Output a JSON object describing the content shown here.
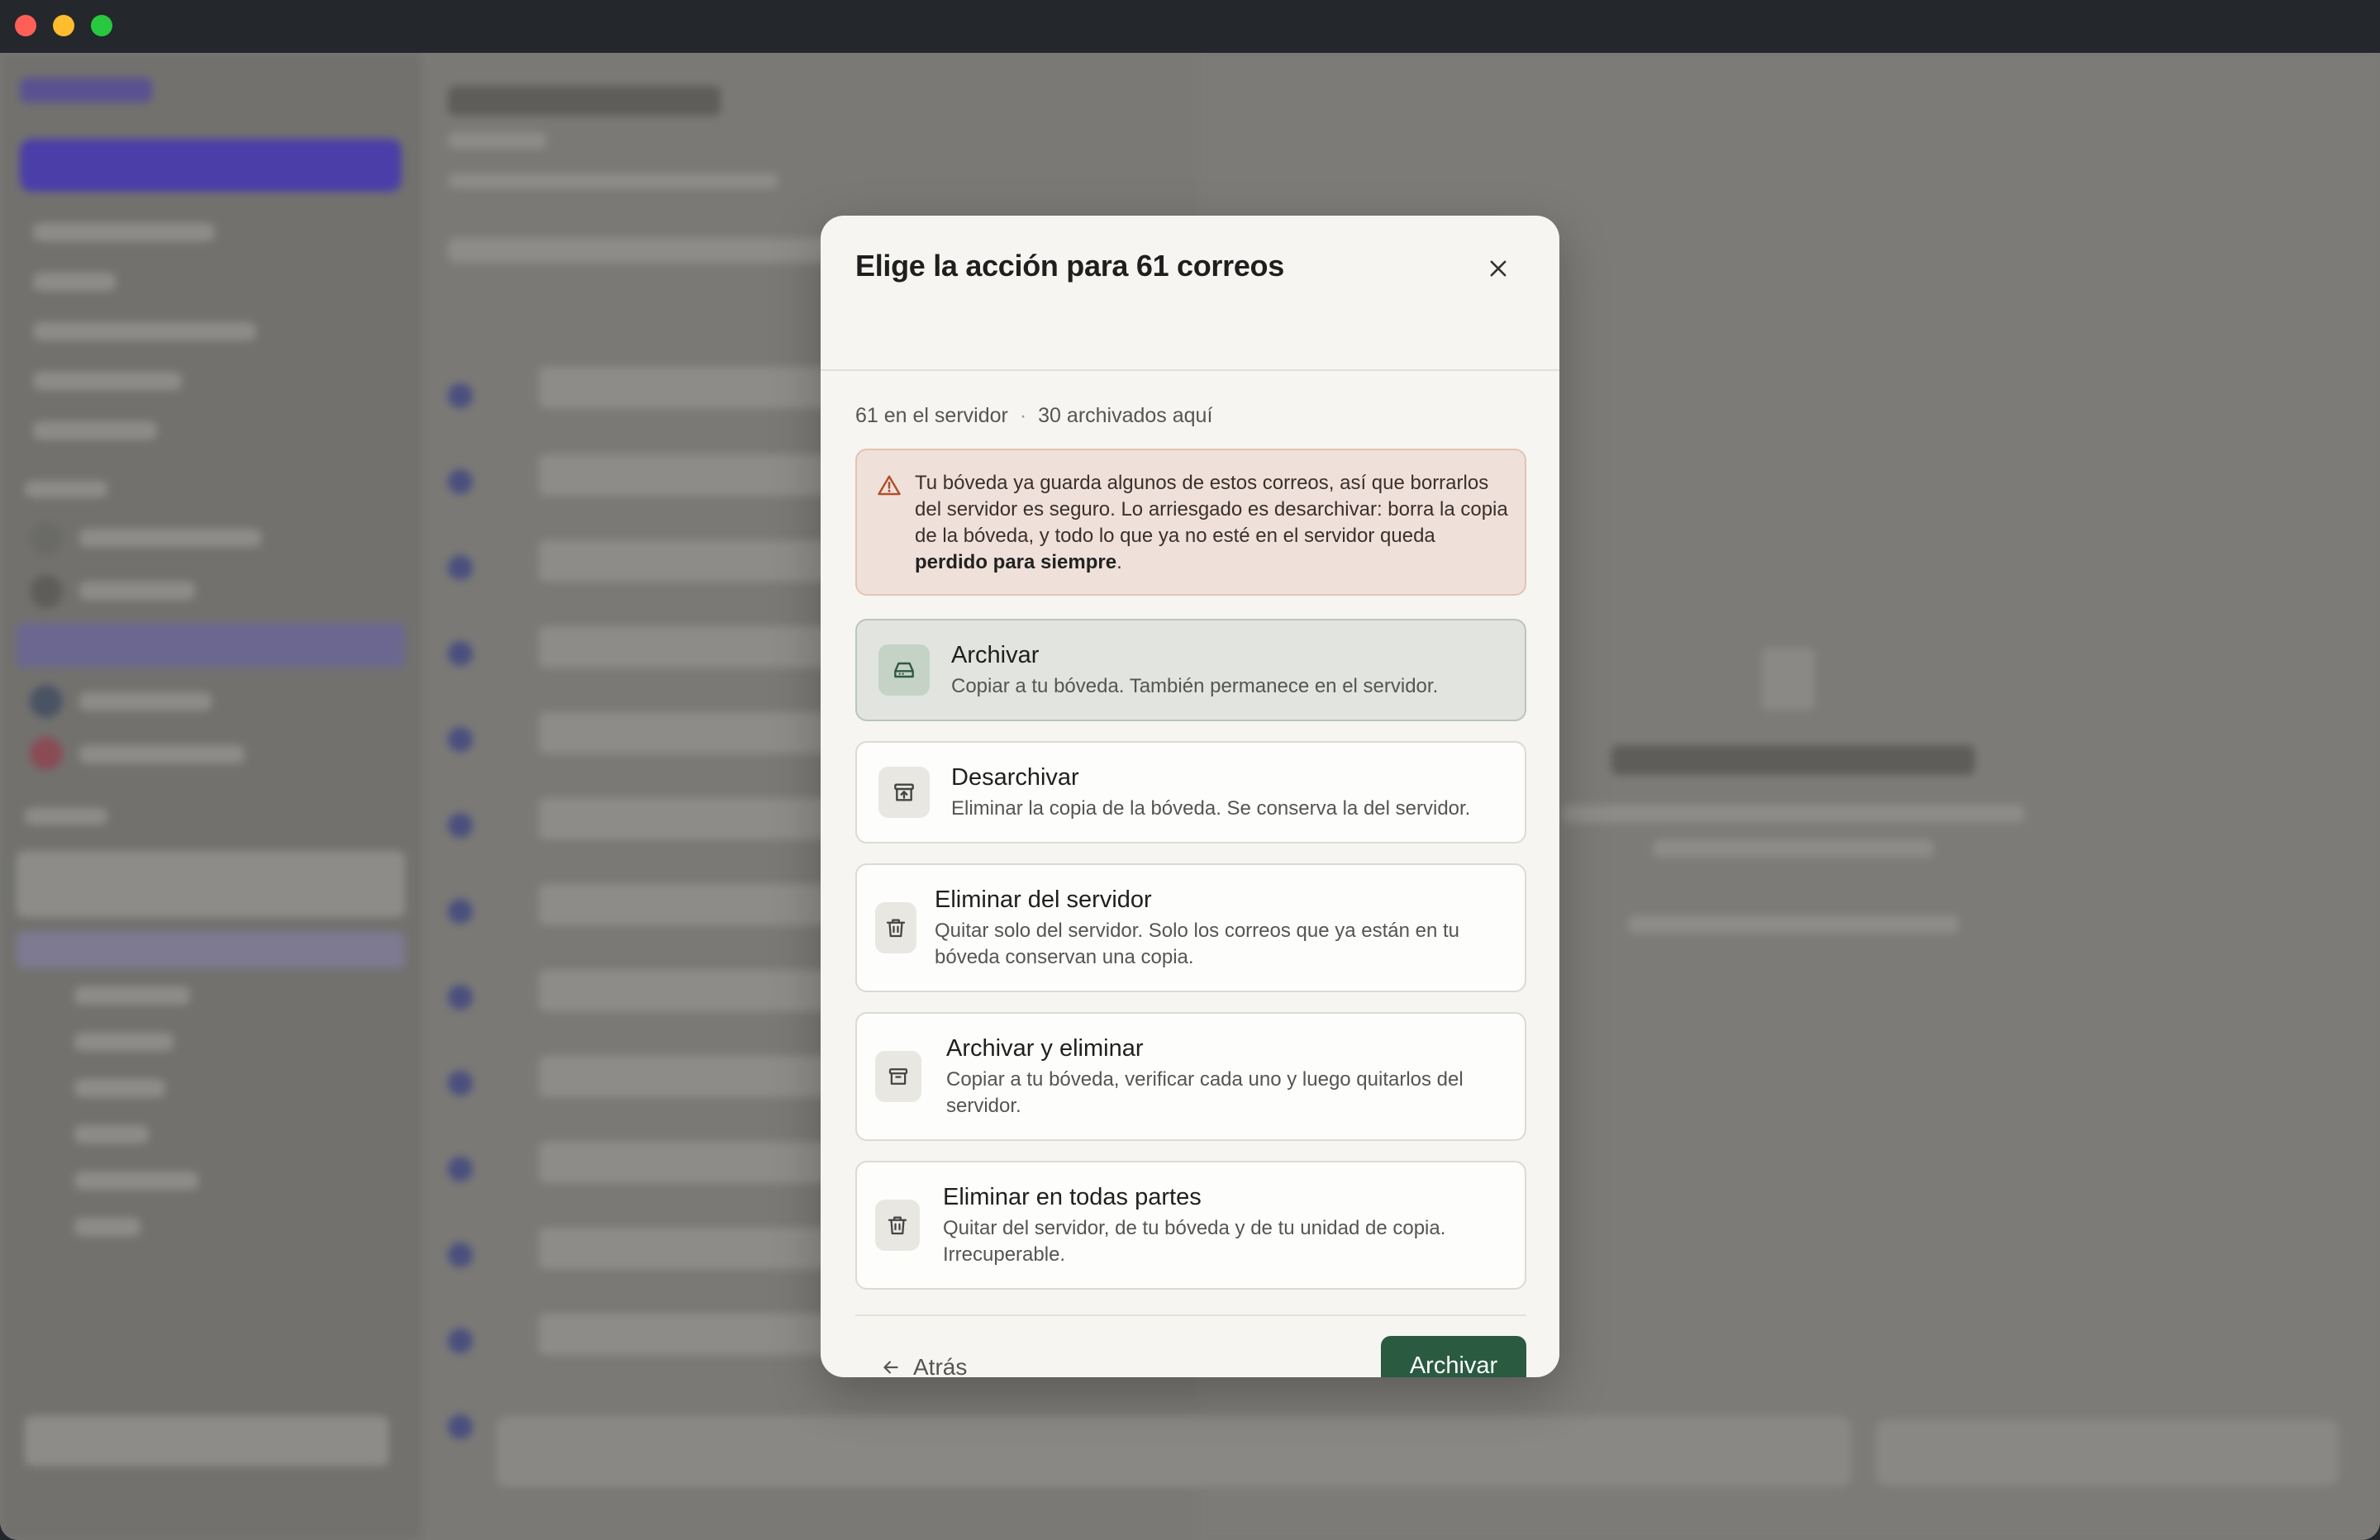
{
  "window": {
    "controls": [
      "close",
      "minimize",
      "maximize"
    ]
  },
  "modal": {
    "title": "Elige la acción para 61 correos",
    "close_icon": "close-icon",
    "counts": {
      "server": "61 en el servidor",
      "separator": "·",
      "archived": "30 archivados aquí"
    },
    "warning": {
      "text": "Tu bóveda ya guarda algunos de estos correos, así que borrarlos del servidor es seguro. Lo arriesgado es desarchivar: borra la copia de la bóveda, y todo lo que ya no esté en el servidor queda ",
      "emphasis": "perdido para siempre",
      "end": "."
    },
    "options": [
      {
        "title": "Archivar",
        "description": "Copiar a tu bóveda. También permanece en el servidor.",
        "icon": "drive-icon",
        "selected": true
      },
      {
        "title": "Desarchivar",
        "description": "Eliminar la copia de la bóveda. Se conserva la del servidor.",
        "icon": "unarchive-icon",
        "selected": false
      },
      {
        "title": "Eliminar del servidor",
        "description": "Quitar solo del servidor. Solo los correos que ya están en tu bóveda conservan una copia.",
        "icon": "trash-icon",
        "selected": false
      },
      {
        "title": "Archivar y eliminar",
        "description": "Copiar a tu bóveda, verificar cada uno y luego quitarlos del servidor.",
        "icon": "archive-box-icon",
        "selected": false
      },
      {
        "title": "Eliminar en todas partes",
        "description": "Quitar del servidor, de tu bóveda y de tu unidad de copia. Irrecuperable.",
        "icon": "trash-icon",
        "selected": false
      }
    ],
    "back_label": "Atrás",
    "confirm_label": "Archivar"
  },
  "colors": {
    "primary": "#2a5a40",
    "selected_bg": "#e1e4df",
    "warning_bg": "#efe1da",
    "warning_border": "#e3c3b3",
    "warning_icon": "#b0502f"
  }
}
